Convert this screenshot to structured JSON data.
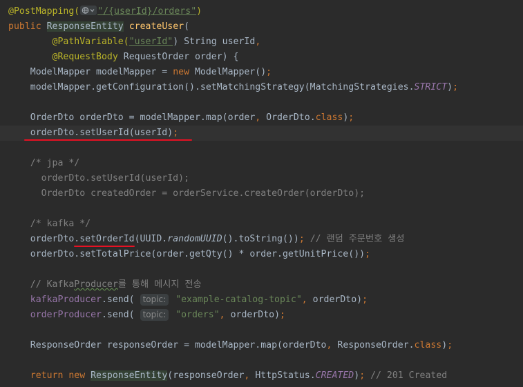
{
  "editor": {
    "theme": {
      "background": "#2b2b2b",
      "keyword": "#cc7832",
      "annotation": "#bbb529",
      "string": "#6a8759",
      "method_decl": "#ffc66d",
      "comment": "#808080",
      "static_field": "#9876aa",
      "highlight_underline": "#e81123"
    },
    "lines": [
      [
        {
          "t": "@PostMapping(",
          "c": "ann"
        },
        {
          "icon": "web-endpoint-icon"
        },
        {
          "t": "\"/{userId}/orders\"",
          "c": "str-u"
        },
        {
          "t": ")",
          "c": "ann"
        }
      ],
      [
        {
          "t": "public ",
          "c": "kw"
        },
        {
          "t": "ResponseEntity",
          "c": "cls-hl"
        },
        {
          "t": " "
        },
        {
          "t": "createUser",
          "c": "fn"
        },
        {
          "t": "("
        }
      ],
      [
        {
          "t": "        "
        },
        {
          "t": "@PathVariable(",
          "c": "ann"
        },
        {
          "t": "\"userId\"",
          "c": "str-u"
        },
        {
          "t": ") String userId"
        },
        {
          "t": ",",
          "c": "kw"
        }
      ],
      [
        {
          "t": "        "
        },
        {
          "t": "@RequestBody",
          "c": "ann"
        },
        {
          "t": " RequestOrder order) {"
        }
      ],
      [
        {
          "t": "    ModelMapper modelMapper = "
        },
        {
          "t": "new ",
          "c": "kw"
        },
        {
          "t": "ModelMapper()"
        },
        {
          "t": ";",
          "c": "kw"
        }
      ],
      [
        {
          "t": "    modelMapper.getConfiguration().setMatchingStrategy(MatchingStrategies."
        },
        {
          "t": "STRICT",
          "c": "static"
        },
        {
          "t": ")"
        },
        {
          "t": ";",
          "c": "kw"
        }
      ],
      [],
      [
        {
          "t": "    OrderDto orderDto = modelMapper.map(order"
        },
        {
          "t": ", ",
          "c": "kw"
        },
        {
          "t": "OrderDto."
        },
        {
          "t": "class",
          "c": "kw"
        },
        {
          "t": ")"
        },
        {
          "t": ";",
          "c": "kw"
        }
      ],
      [
        {
          "t": "    orderDto.setUserId(userId)"
        },
        {
          "t": ";",
          "c": "kw"
        }
      ],
      [],
      [
        {
          "t": "    /* jpa */",
          "c": "cmt"
        }
      ],
      [
        {
          "t": "      orderDto.setUserId(userId);",
          "c": "cmt"
        }
      ],
      [
        {
          "t": "      OrderDto createdOrder = orderService.createOrder(orderDto);",
          "c": "cmt"
        }
      ],
      [],
      [
        {
          "t": "    /* kafka */",
          "c": "cmt"
        }
      ],
      [
        {
          "t": "    orderDto.setOrderId(UUID."
        },
        {
          "t": "randomUUID",
          "c": "it"
        },
        {
          "t": "().toString())"
        },
        {
          "t": ";",
          "c": "kw"
        },
        {
          "t": " // 랜덤 주문번호 생성",
          "c": "cmt"
        }
      ],
      [
        {
          "t": "    orderDto.setTotalPrice(order.getQty() * order.getUnitPrice())"
        },
        {
          "t": ";",
          "c": "kw"
        }
      ],
      [],
      [
        {
          "t": "    // Kafka",
          "c": "cmt"
        },
        {
          "t": "Producer",
          "c": "cmt warn-u"
        },
        {
          "t": "를 통해 메시지 전송",
          "c": "cmt"
        }
      ],
      [
        {
          "t": "    "
        },
        {
          "t": "kafkaProducer",
          "c": "field"
        },
        {
          "t": ".send( "
        },
        {
          "hint": "topic:"
        },
        {
          "t": " \"example-catalog-topic\"",
          "c": "str"
        },
        {
          "t": ", ",
          "c": "kw"
        },
        {
          "t": "orderDto)"
        },
        {
          "t": ";",
          "c": "kw"
        }
      ],
      [
        {
          "t": "    "
        },
        {
          "t": "orderProducer",
          "c": "field"
        },
        {
          "t": ".send( "
        },
        {
          "hint": "topic:"
        },
        {
          "t": " \"orders\"",
          "c": "str"
        },
        {
          "t": ", ",
          "c": "kw"
        },
        {
          "t": "orderDto)"
        },
        {
          "t": ";",
          "c": "kw"
        }
      ],
      [],
      [
        {
          "t": "    ResponseOrder responseOrder = modelMapper.map(orderDto"
        },
        {
          "t": ", ",
          "c": "kw"
        },
        {
          "t": "ResponseOrder."
        },
        {
          "t": "class",
          "c": "kw"
        },
        {
          "t": ")"
        },
        {
          "t": ";",
          "c": "kw"
        }
      ],
      [],
      [
        {
          "t": "    "
        },
        {
          "t": "return new ",
          "c": "kw"
        },
        {
          "t": "ResponseEntity",
          "c": "cls-hl"
        },
        {
          "t": "(responseOrder"
        },
        {
          "t": ", ",
          "c": "kw"
        },
        {
          "t": "HttpStatus."
        },
        {
          "t": "CREATED",
          "c": "static"
        },
        {
          "t": ")"
        },
        {
          "t": ";",
          "c": "kw"
        },
        {
          "t": " // 201 Created",
          "c": "cmt"
        }
      ]
    ]
  }
}
